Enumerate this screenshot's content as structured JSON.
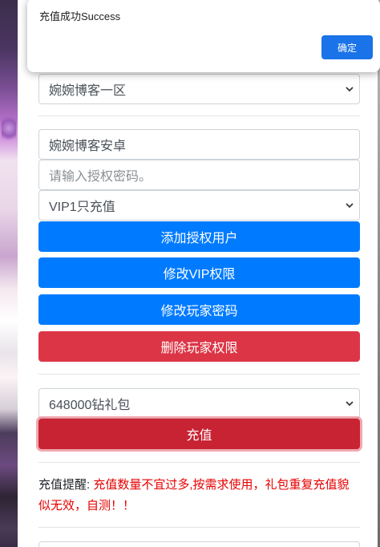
{
  "dialog": {
    "message": "充值成功Success",
    "ok_label": "确定"
  },
  "server_select": {
    "value": "婉婉博客一区"
  },
  "auth": {
    "username_value": "婉婉博客安卓",
    "password_placeholder": "请输入授权密码。",
    "vip_select_value": "VIP1只充值",
    "add_user_label": "添加授权用户",
    "modify_vip_label": "修改VIP权限",
    "modify_password_label": "修改玩家密码",
    "delete_permission_label": "删除玩家权限"
  },
  "recharge": {
    "package_select_value": "648000钻礼包",
    "recharge_label": "充值"
  },
  "reminder": {
    "prefix": "充值提醒: ",
    "text": "充值数量不宜过多,按需求使用，礼包重复充值貌似无效，自测！！"
  },
  "colors": {
    "primary": "#007bff",
    "danger": "#dc3545",
    "dialog_button": "#1a73e8",
    "reminder_red": "#e60000"
  }
}
